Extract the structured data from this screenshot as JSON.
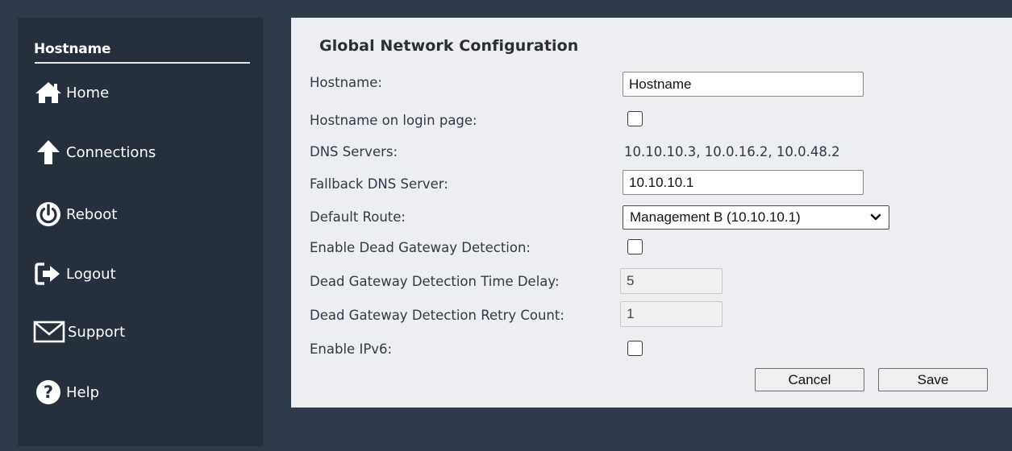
{
  "sidebar": {
    "title": "Hostname",
    "items": [
      {
        "label": "Home",
        "icon": "home-icon"
      },
      {
        "label": "Connections",
        "icon": "arrow-up-icon"
      },
      {
        "label": "Reboot",
        "icon": "power-icon"
      },
      {
        "label": "Logout",
        "icon": "logout-icon"
      },
      {
        "label": "Support",
        "icon": "envelope-icon"
      },
      {
        "label": "Help",
        "icon": "question-icon"
      }
    ]
  },
  "form": {
    "title": "Global Network Configuration",
    "hostname_label": "Hostname:",
    "hostname_value": "Hostname",
    "hostname_login_label": "Hostname on login page:",
    "hostname_login_checked": false,
    "dns_servers_label": "DNS Servers:",
    "dns_servers_value": "10.10.10.3, 10.0.16.2, 10.0.48.2",
    "fallback_dns_label": "Fallback DNS Server:",
    "fallback_dns_value": "10.10.10.1",
    "default_route_label": "Default Route:",
    "default_route_value": "Management B (10.10.10.1)",
    "dead_gateway_label": "Enable Dead Gateway Detection:",
    "dead_gateway_checked": false,
    "time_delay_label": "Dead Gateway Detection Time Delay:",
    "time_delay_value": "5",
    "retry_count_label": "Dead Gateway Detection Retry Count:",
    "retry_count_value": "1",
    "ipv6_label": "Enable IPv6:",
    "ipv6_checked": false,
    "cancel_label": "Cancel",
    "save_label": "Save"
  },
  "colors": {
    "background": "#2e3a4a",
    "sidebar": "#262f3c",
    "panel": "#eceef1"
  }
}
